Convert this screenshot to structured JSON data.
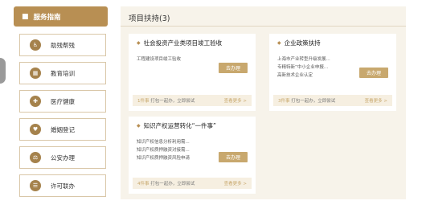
{
  "sidebar": {
    "header": "服务指南",
    "items": [
      {
        "label": "助残帮残",
        "icon": "♿"
      },
      {
        "label": "教育培训",
        "icon": "▦"
      },
      {
        "label": "医疗健康",
        "icon": "✚"
      },
      {
        "label": "婚姻登记",
        "icon": "♥"
      },
      {
        "label": "公安办理",
        "icon": "⚖"
      },
      {
        "label": "许可联办",
        "icon": "☰"
      }
    ]
  },
  "main": {
    "title": "项目扶持(3)",
    "cards": [
      {
        "title": "社会投资产业类项目竣工验收",
        "items": [
          "工程建设项目竣工验收"
        ],
        "button": "去办理",
        "footer_count": "1件事",
        "footer_text": " 打包一起办，立即尝试",
        "more": "查看更多 >"
      },
      {
        "title": "企业政策扶持",
        "items": [
          "上海市产业转型升级发展...",
          "专精特新”中小企业申报...",
          "高新技术企业认定"
        ],
        "button": "去办理",
        "footer_count": "3件事",
        "footer_text": " 打包一起办，立即尝试",
        "more": "查看更多 >"
      },
      {
        "title": "知识产权运营转化“一件事”",
        "items": [
          "知识产权信息分析利用需...",
          "知识产权质押融资对接需...",
          "知识产权质押融资风险申请"
        ],
        "button": "去办理",
        "footer_count": "4件事",
        "footer_text": " 打包一起办，立即尝试",
        "more": "查看更多 >"
      }
    ]
  }
}
